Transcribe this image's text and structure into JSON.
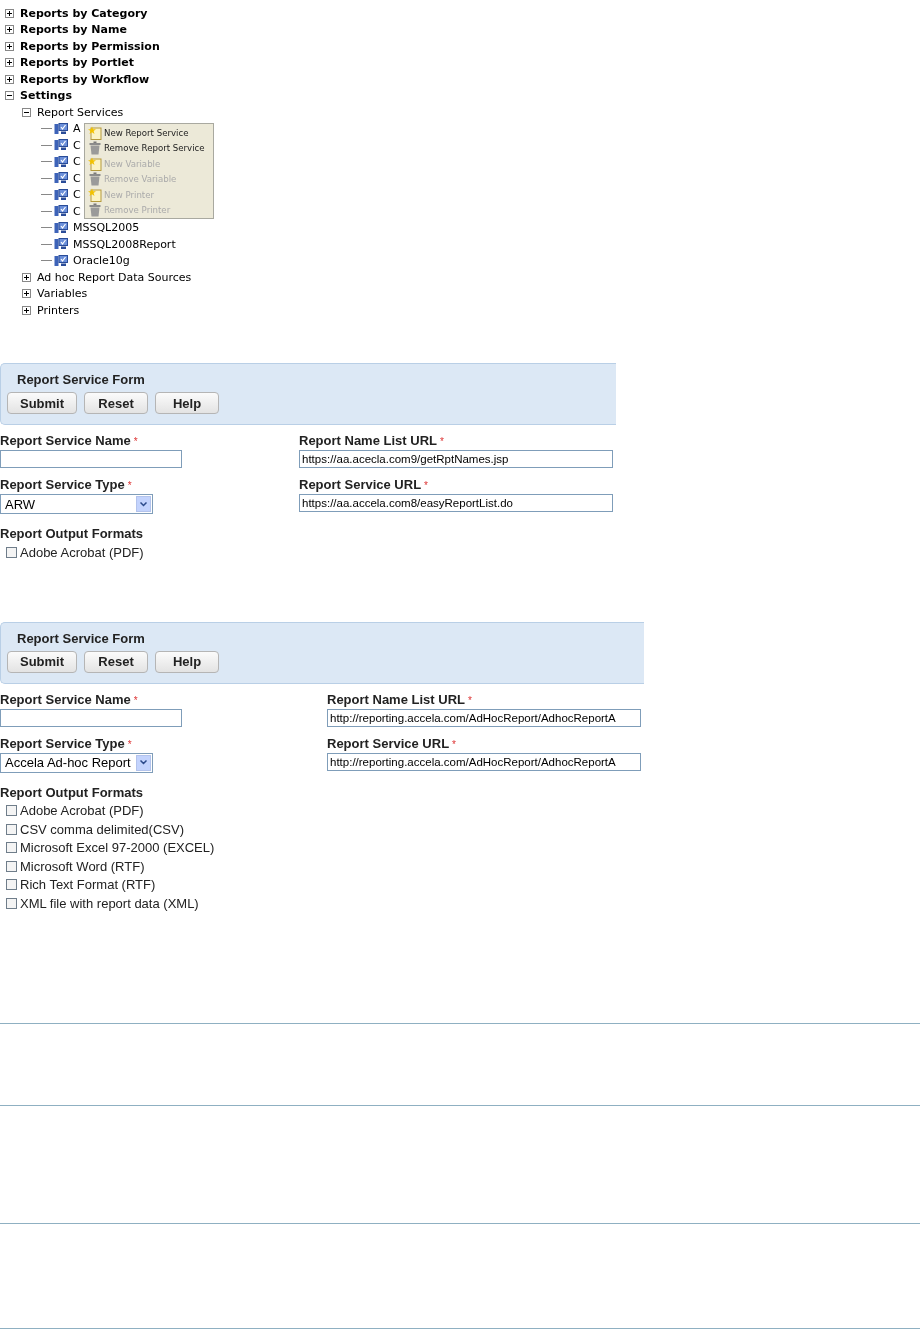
{
  "tree": [
    {
      "label": "Reports by Category",
      "kind": "folder",
      "expanded": false
    },
    {
      "label": "Reports by Name",
      "kind": "folder",
      "expanded": false
    },
    {
      "label": "Reports by Permission",
      "kind": "folder",
      "expanded": false
    },
    {
      "label": "Reports by Portlet",
      "kind": "folder",
      "expanded": false
    },
    {
      "label": "Reports by Workflow",
      "kind": "folder",
      "expanded": false
    },
    {
      "label": "Settings",
      "kind": "folder",
      "expanded": true,
      "children": [
        {
          "label": "Report Services",
          "kind": "folder",
          "expanded": true,
          "children": [
            {
              "label": "A",
              "kind": "service"
            },
            {
              "label": "C",
              "kind": "service"
            },
            {
              "label": "C",
              "kind": "service"
            },
            {
              "label": "C",
              "kind": "service"
            },
            {
              "label": "C",
              "kind": "service"
            },
            {
              "label": "C",
              "kind": "service"
            },
            {
              "label": "MSSQL2005",
              "kind": "service"
            },
            {
              "label": "MSSQL2008Report",
              "kind": "service"
            },
            {
              "label": "Oracle10g",
              "kind": "service"
            }
          ]
        },
        {
          "label": "Ad hoc Report Data Sources",
          "kind": "folder",
          "expanded": false
        },
        {
          "label": "Variables",
          "kind": "folder",
          "expanded": false
        },
        {
          "label": "Printers",
          "kind": "folder",
          "expanded": false
        }
      ]
    }
  ],
  "context_menu": [
    {
      "label": "New Report Service",
      "kind": "new",
      "disabled": false
    },
    {
      "label": "Remove Report Service",
      "kind": "remove",
      "disabled": false
    },
    {
      "label": "New Variable",
      "kind": "new",
      "disabled": true
    },
    {
      "label": "Remove Variable",
      "kind": "remove",
      "disabled": true
    },
    {
      "label": "New Printer",
      "kind": "new",
      "disabled": true
    },
    {
      "label": "Remove Printer",
      "kind": "remove",
      "disabled": true
    }
  ],
  "forms": [
    {
      "title": "Report Service Form",
      "buttons": [
        "Submit",
        "Reset",
        "Help"
      ],
      "service_name": {
        "label": "Report Service Name",
        "required": "*"
      },
      "service_type": {
        "label": "Report Service Type",
        "required": "*",
        "value": "ARW"
      },
      "name_list_url": {
        "label": "Report Name List URL",
        "required": "*",
        "value": "https://aa.acecla.com9/getRptNames.jsp"
      },
      "service_url": {
        "label": "Report Service URL",
        "required": "*",
        "value": "https://aa.accela.com8/easyReportList.do"
      },
      "output_formats": {
        "label": "Report Output Formats",
        "options": [
          {
            "label": "Adobe Acrobat (PDF)",
            "checked": false
          }
        ]
      }
    },
    {
      "title": "Report Service Form",
      "buttons": [
        "Submit",
        "Reset",
        "Help"
      ],
      "service_name": {
        "label": "Report Service Name",
        "required": "*"
      },
      "service_type": {
        "label": "Report Service Type",
        "required": "*",
        "value": "Accela Ad-hoc Report"
      },
      "name_list_url": {
        "label": "Report Name List URL",
        "required": "*",
        "value": "http://reporting.accela.com/AdHocReport/AdhocReportA"
      },
      "service_url": {
        "label": "Report Service URL",
        "required": "*",
        "value": "http://reporting.accela.com/AdHocReport/AdhocReportA"
      },
      "output_formats": {
        "label": "Report Output Formats",
        "options": [
          {
            "label": "Adobe Acrobat (PDF)",
            "checked": false
          },
          {
            "label": "CSV comma delimited(CSV)",
            "checked": false
          },
          {
            "label": "Microsoft Excel 97-2000 (EXCEL)",
            "checked": false
          },
          {
            "label": "Microsoft Word (RTF)",
            "checked": false
          },
          {
            "label": "Rich Text Format (RTF)",
            "checked": false
          },
          {
            "label": "XML file with report data (XML)",
            "checked": false
          }
        ]
      }
    }
  ]
}
